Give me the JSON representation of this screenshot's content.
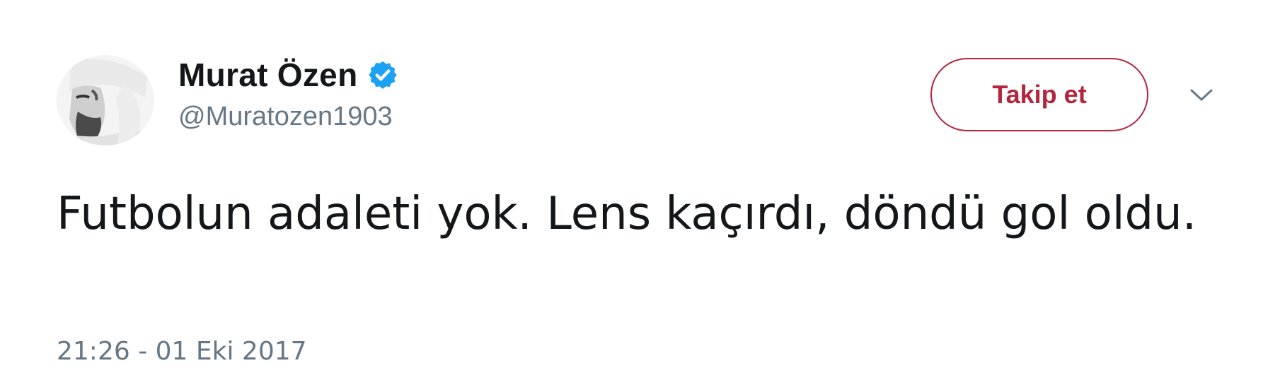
{
  "tweet": {
    "author": {
      "display_name": "Murat Özen",
      "handle": "@Muratozen1903",
      "verified": true,
      "verified_icon": "verified-badge-icon"
    },
    "follow_label": "Takip et",
    "menu_icon": "chevron-down-icon",
    "text": "Futbolun adaleti yok. Lens kaçırdı, döndü gol oldu.",
    "timestamp": "21:26 - 01 Eki 2017"
  },
  "colors": {
    "follow_accent": "#b3263e",
    "verified_blue": "#1da1f2",
    "secondary_text": "#657786",
    "primary_text": "#14171a"
  }
}
